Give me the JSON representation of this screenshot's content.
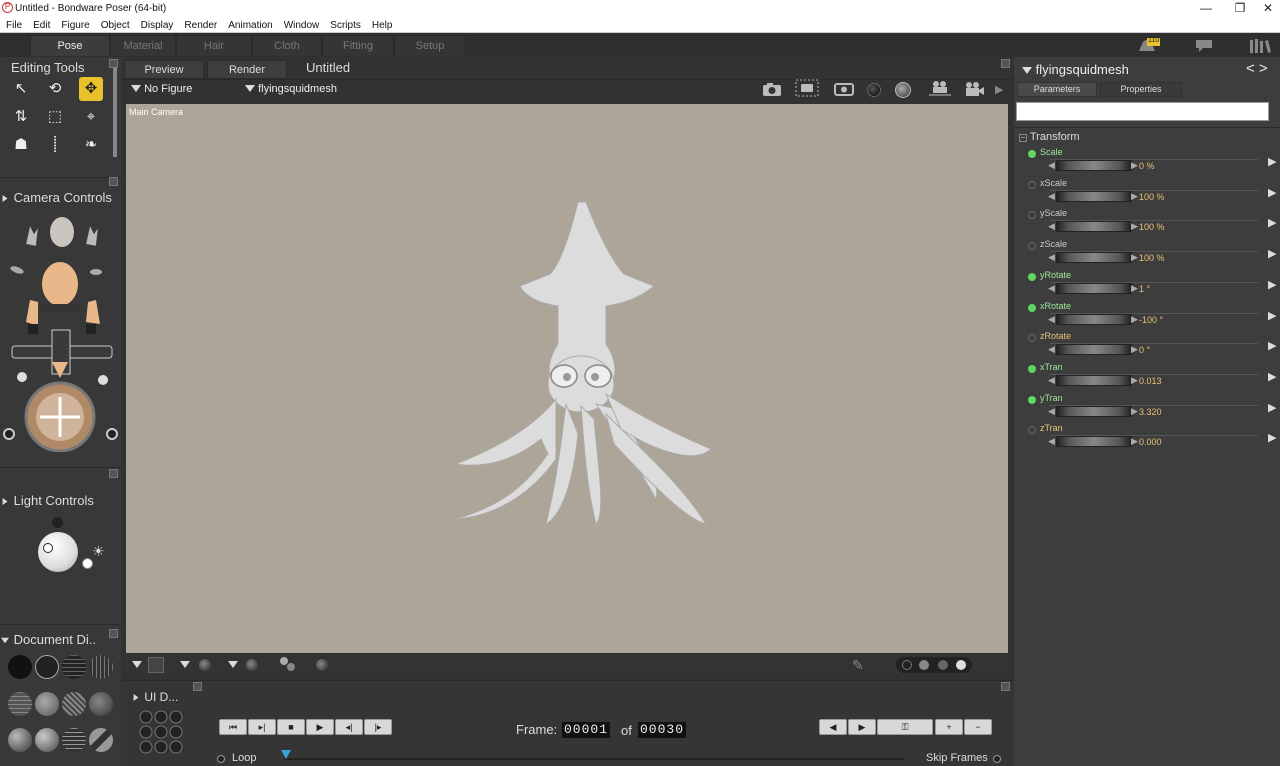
{
  "window": {
    "title": "Untitled - Bondware Poser (64-bit)",
    "minimize": "—",
    "restore": "❐",
    "close": "✕"
  },
  "menu": [
    "File",
    "Edit",
    "Figure",
    "Object",
    "Display",
    "Render",
    "Animation",
    "Window",
    "Scripts",
    "Help"
  ],
  "rooms": [
    {
      "label": "Pose",
      "active": true
    },
    {
      "label": "Material",
      "active": false
    },
    {
      "label": "Hair",
      "active": false
    },
    {
      "label": "Cloth",
      "active": false
    },
    {
      "label": "Fitting",
      "active": false
    },
    {
      "label": "Setup",
      "active": false
    }
  ],
  "notification_badge": "110",
  "editing_tools": {
    "title": "Editing Tools"
  },
  "camera_controls": {
    "title": "Camera Controls"
  },
  "light_controls": {
    "title": "Light Controls"
  },
  "document_display": {
    "title": "Document Di.."
  },
  "ui_dots": {
    "title": "UI D..."
  },
  "document": {
    "tabs": [
      "Preview",
      "Render"
    ],
    "title": "Untitled",
    "figure_selector": "No Figure",
    "object_selector": "flyingsquidmesh",
    "camera_label": "Main Camera"
  },
  "parameters": {
    "actor": "flyingsquidmesh",
    "tabs": [
      "Parameters",
      "Properties"
    ],
    "search_placeholder": "",
    "group": "Transform",
    "items": [
      {
        "name": "Scale",
        "value": "0 %",
        "keyed": true
      },
      {
        "name": "xScale",
        "value": "100 %",
        "keyed": false
      },
      {
        "name": "yScale",
        "value": "100 %",
        "keyed": false
      },
      {
        "name": "zScale",
        "value": "100 %",
        "keyed": false
      },
      {
        "name": "yRotate",
        "value": "1 °",
        "keyed": true
      },
      {
        "name": "xRotate",
        "value": "-100 °",
        "keyed": true
      },
      {
        "name": "zRotate",
        "value": "0 °",
        "keyed": false
      },
      {
        "name": "xTran",
        "value": "0.013",
        "keyed": true
      },
      {
        "name": "yTran",
        "value": "3.320",
        "keyed": true
      },
      {
        "name": "zTran",
        "value": "0.000",
        "keyed": false
      }
    ]
  },
  "timeline": {
    "frame_label": "Frame:",
    "current_frame": "00001",
    "of_label": "of",
    "total_frames": "00030",
    "loop_label": "Loop",
    "skip_frames_label": "Skip Frames"
  },
  "colors": {
    "accent": "#e9c12a",
    "keyed_dot": "#5fd65f",
    "canvas_bg": "#ada597",
    "value_text": "#e8c27a"
  }
}
